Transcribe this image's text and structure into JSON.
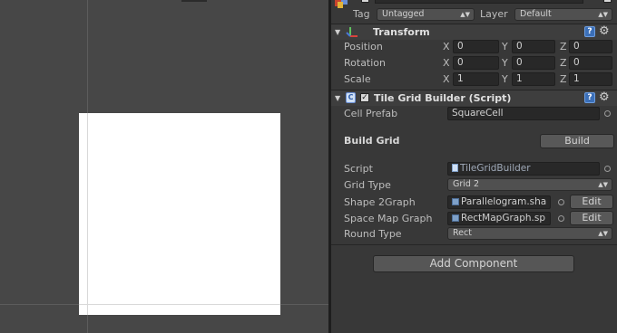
{
  "header": {
    "tag_label": "Tag",
    "tag_value": "Untagged",
    "layer_label": "Layer",
    "layer_value": "Default"
  },
  "transform": {
    "title": "Transform",
    "rows": [
      {
        "label": "Position",
        "x": "0",
        "y": "0",
        "z": "0"
      },
      {
        "label": "Rotation",
        "x": "0",
        "y": "0",
        "z": "0"
      },
      {
        "label": "Scale",
        "x": "1",
        "y": "1",
        "z": "1"
      }
    ],
    "axis_x": "X",
    "axis_y": "Y",
    "axis_z": "Z"
  },
  "builder": {
    "title": "Tile Grid Builder (Script)",
    "cell_prefab_label": "Cell Prefab",
    "cell_prefab_value": "SquareCell",
    "build_grid_label": "Build Grid",
    "build_button": "Build",
    "script_label": "Script",
    "script_value": "TileGridBuilder",
    "grid_type_label": "Grid Type",
    "grid_type_value": "Grid 2",
    "shape_label": "Shape 2Graph",
    "shape_value": "Parallelogram.sha",
    "space_label": "Space Map Graph",
    "space_value": "RectMapGraph.sp",
    "edit_button": "Edit",
    "round_label": "Round Type",
    "round_value": "Rect"
  },
  "add_component": "Add Component",
  "colors": {
    "inspector_bg": "#383838",
    "scene_bg": "#474747",
    "sprite": "#ffffff",
    "help_blue": "#3b6fb8"
  }
}
